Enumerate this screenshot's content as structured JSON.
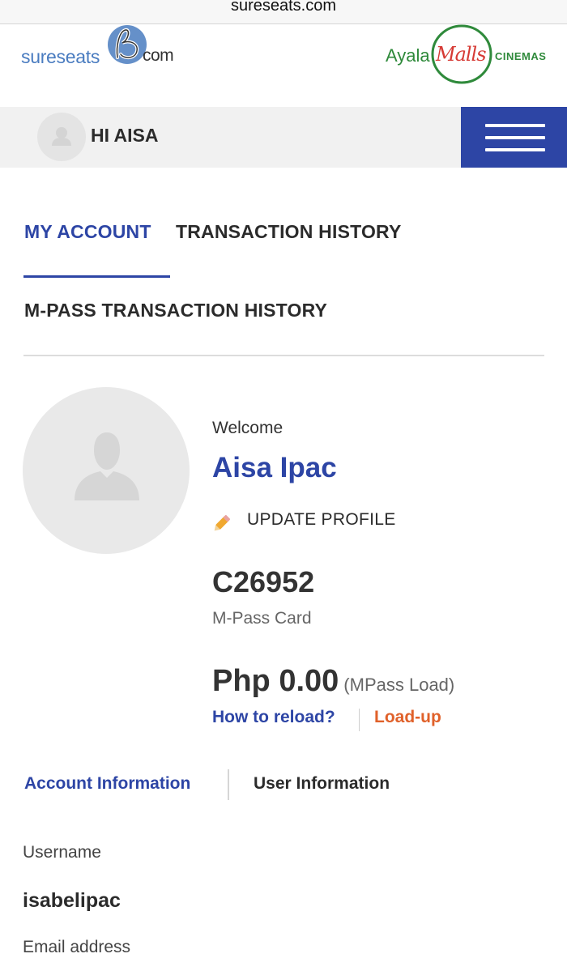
{
  "browser": {
    "url": "sureseats.com"
  },
  "brand": {
    "left_logo": {
      "part1": "sureseats",
      "part2": "com"
    },
    "right_logo": {
      "part1": "Ayala",
      "part2": "Malls",
      "part3": "CINEMAS"
    }
  },
  "userbar": {
    "greeting": "HI AISA"
  },
  "tabs": [
    {
      "label": "MY ACCOUNT",
      "active": true
    },
    {
      "label": "TRANSACTION HISTORY",
      "active": false
    },
    {
      "label": "M-PASS TRANSACTION HISTORY",
      "active": false
    }
  ],
  "profile": {
    "welcome": "Welcome",
    "name": "Aisa Ipac",
    "update_label": "UPDATE PROFILE",
    "card_number": "C26952",
    "card_label": "M-Pass Card",
    "balance": "Php 0.00",
    "balance_note": "(MPass Load)",
    "reload_link": "How to reload?",
    "loadup_link": "Load-up"
  },
  "subtabs": [
    {
      "label": "Account Information",
      "active": true
    },
    {
      "label": "User Information",
      "active": false
    }
  ],
  "account_info": {
    "username_label": "Username",
    "username_value": "isabelipac",
    "email_label": "Email address"
  },
  "colors": {
    "accent_blue": "#2d45a5",
    "loadup_orange": "#e0612a",
    "logo_blue": "#4a7cc0",
    "logo_green": "#2f8a3b",
    "logo_red": "#d63a34"
  },
  "icons": [
    "user-silhouette-icon",
    "hamburger-menu-icon",
    "pencil-icon"
  ]
}
